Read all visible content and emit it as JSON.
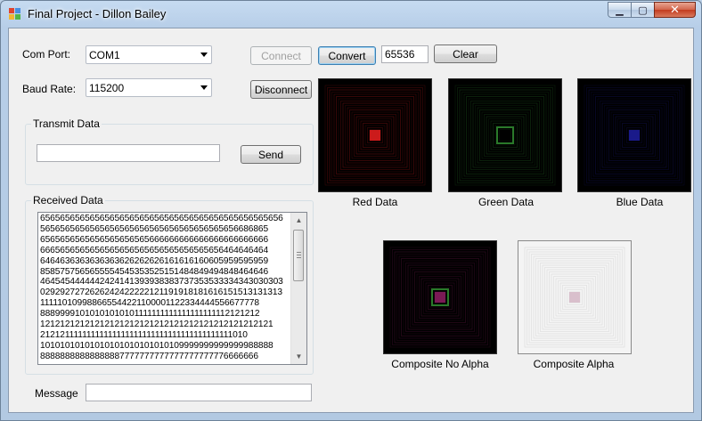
{
  "window": {
    "title": "Final Project - Dillon Bailey",
    "controls": {
      "minimize": "▁",
      "maximize": "▢",
      "close": "✕"
    }
  },
  "serial": {
    "com_port_label": "Com Port:",
    "com_port_value": "COM1",
    "baud_rate_label": "Baud Rate:",
    "baud_rate_value": "115200"
  },
  "buttons": {
    "connect": "Connect",
    "disconnect": "Disconnect",
    "convert": "Convert",
    "clear": "Clear",
    "send": "Send"
  },
  "convert_value": "65536",
  "transmit": {
    "group_label": "Transmit Data",
    "input_value": ""
  },
  "received": {
    "group_label": "Received Data",
    "lines": [
      "6565656565656565656565656565656565656565656565656",
      "5656565656565656565656565656565656565656686865",
      "6565656565656565656565666666666666666666666666",
      "6665656565656565656565656565656565656464646464",
      "6464636363636363626262626161616160605959595959",
      "8585757565655554545353525151484849494848464646",
      "4645454444442424141393938383737353533334343030303",
      "0292927272626242422222121191918181616151513131313",
      "111110109988665544221100001122334444556677778",
      "88899991010101010101111111111111111111112121212",
      "12121212121212121212121212121212121212121212121",
      "21212111111111111111111111111111111111111111010",
      "10101010101010101010101010109999999999999988888",
      "88888888888888887777777777777777777776666666"
    ]
  },
  "message": {
    "label": "Message",
    "value": ""
  },
  "images": {
    "red": {
      "caption": "Red Data",
      "color": "#cc1b1b"
    },
    "green": {
      "caption": "Green Data",
      "color": "#2a7a2a"
    },
    "blue": {
      "caption": "Blue Data",
      "color": "#1a1a8a"
    },
    "composite_no_alpha": {
      "caption": "Composite No Alpha",
      "color": "#7a1a55"
    },
    "composite_alpha": {
      "caption": "Composite Alpha",
      "color": "#d9bfcc"
    }
  }
}
